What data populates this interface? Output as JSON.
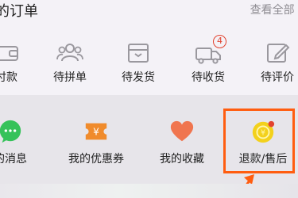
{
  "orders": {
    "title": "的订单",
    "view_all": "查看全部",
    "items": [
      {
        "label": "付款",
        "icon": "wallet-icon"
      },
      {
        "label": "待拼单",
        "icon": "group-users-icon"
      },
      {
        "label": "待发货",
        "icon": "package-box-icon"
      },
      {
        "label": "待收货",
        "icon": "delivery-truck-icon",
        "badge": "4"
      },
      {
        "label": "待评价",
        "icon": "edit-review-icon"
      }
    ]
  },
  "tools": {
    "items": [
      {
        "label": "的消息",
        "icon": "chat-bubble-icon"
      },
      {
        "label": "我的优惠券",
        "icon": "coupon-ticket-icon"
      },
      {
        "label": "我的收藏",
        "icon": "heart-icon"
      },
      {
        "label": "退款/售后",
        "icon": "refund-coin-icon"
      }
    ]
  },
  "colors": {
    "accent": "#ff5d10",
    "badge": "#e2432f",
    "coupon": "#f08b2c",
    "heart": "#f0754f",
    "message": "#36c25a",
    "refund": "#f3d11c"
  }
}
